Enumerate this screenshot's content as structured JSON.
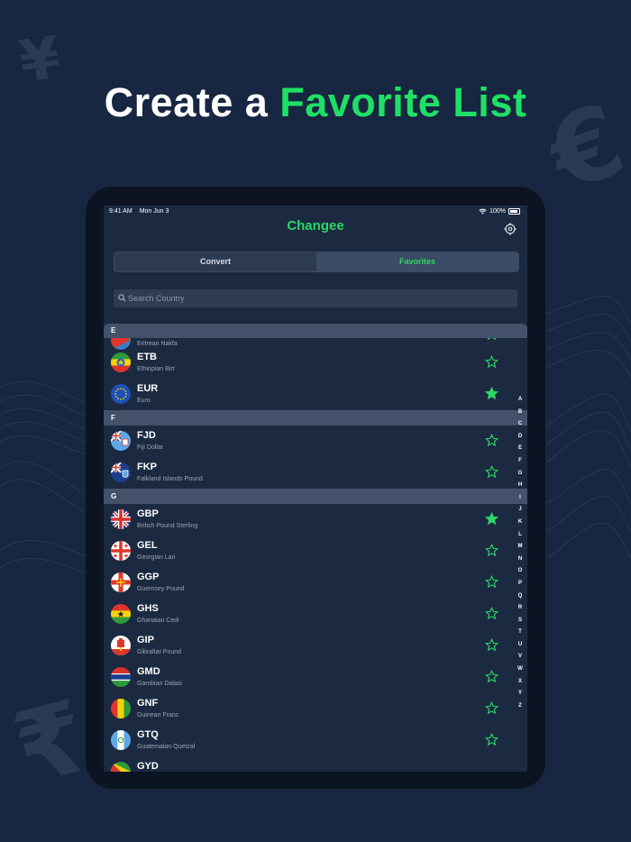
{
  "headline": {
    "prefix": "Create a ",
    "accent": "Favorite List"
  },
  "background_symbols": {
    "yen": "¥",
    "euro": "€",
    "rupee": "₹"
  },
  "status_bar": {
    "time": "9:41 AM",
    "date": "Mon Jun 3",
    "battery": "100%"
  },
  "app": {
    "title": "Changee"
  },
  "tabs": {
    "convert": "Convert",
    "favorites": "Favorites",
    "selected": "Favorites"
  },
  "search": {
    "placeholder": "Search Country",
    "value": ""
  },
  "sections": {
    "e": "E",
    "f": "F",
    "g": "G"
  },
  "currencies": [
    {
      "code": "",
      "name": "Eritrean Nakfa",
      "favorite": false,
      "flag": "eritrea-flag"
    },
    {
      "code": "ETB",
      "name": "Ethiopian Birr",
      "favorite": false,
      "flag": "ethiopia-flag"
    },
    {
      "code": "EUR",
      "name": "Euro",
      "favorite": true,
      "flag": "eu-flag"
    },
    {
      "code": "FJD",
      "name": "Fiji Dollar",
      "favorite": false,
      "flag": "fiji-flag"
    },
    {
      "code": "FKP",
      "name": "Falkland Islands Pound",
      "favorite": false,
      "flag": "falkland-flag"
    },
    {
      "code": "GBP",
      "name": "British Pound Sterling",
      "favorite": true,
      "flag": "uk-flag"
    },
    {
      "code": "GEL",
      "name": "Georgian Lari",
      "favorite": false,
      "flag": "georgia-flag"
    },
    {
      "code": "GGP",
      "name": "Guernsey Pound",
      "favorite": false,
      "flag": "guernsey-flag"
    },
    {
      "code": "GHS",
      "name": "Ghanaian Cedi",
      "favorite": false,
      "flag": "ghana-flag"
    },
    {
      "code": "GIP",
      "name": "Gibraltar Pound",
      "favorite": false,
      "flag": "gibraltar-flag"
    },
    {
      "code": "GMD",
      "name": "Gambian Dalasi",
      "favorite": false,
      "flag": "gambia-flag"
    },
    {
      "code": "GNF",
      "name": "Guinean Franc",
      "favorite": false,
      "flag": "guinea-flag"
    },
    {
      "code": "GTQ",
      "name": "Guatemalan Quetzal",
      "favorite": false,
      "flag": "guatemala-flag"
    },
    {
      "code": "GYD",
      "name": "",
      "favorite": false,
      "flag": "guyana-flag"
    }
  ],
  "alphabet_index": [
    "A",
    "B",
    "C",
    "D",
    "E",
    "F",
    "G",
    "H",
    "I",
    "J",
    "K",
    "L",
    "M",
    "N",
    "O",
    "P",
    "Q",
    "R",
    "S",
    "T",
    "U",
    "V",
    "W",
    "X",
    "Y",
    "Z"
  ],
  "colors": {
    "accent": "#2cd667",
    "background": "#172641",
    "screen": "#1c2a41",
    "section_header": "#43526a"
  }
}
